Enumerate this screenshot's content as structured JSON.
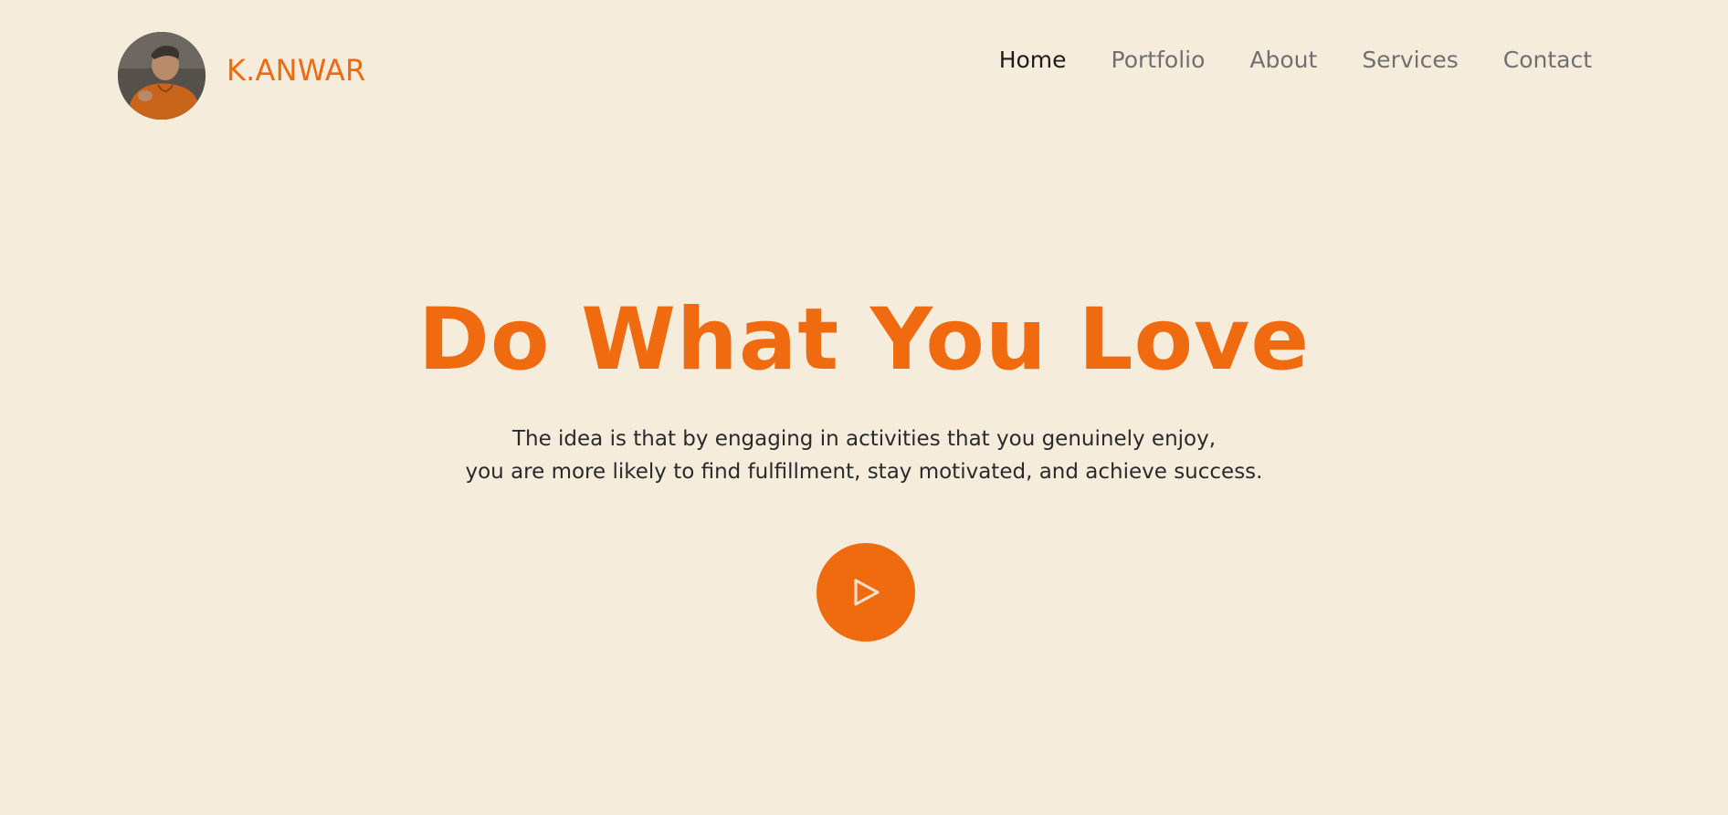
{
  "header": {
    "brand": "K.ANWAR",
    "nav": [
      {
        "label": "Home",
        "active": true
      },
      {
        "label": "Portfolio",
        "active": false
      },
      {
        "label": "About",
        "active": false
      },
      {
        "label": "Services",
        "active": false
      },
      {
        "label": "Contact",
        "active": false
      }
    ]
  },
  "hero": {
    "title": "Do What You Love",
    "subtitle_lines": [
      "The idea is that by engaging in activities that you genuinely enjoy,",
      "you are more likely to find fulfillment, stay motivated, and achieve success."
    ],
    "play_icon": "play-icon"
  },
  "colors": {
    "background": "#f6ecdc",
    "accent": "#f06a0f",
    "nav_active": "#1c1c1c",
    "nav_inactive": "#707070",
    "body_text": "#2a2a2a"
  }
}
